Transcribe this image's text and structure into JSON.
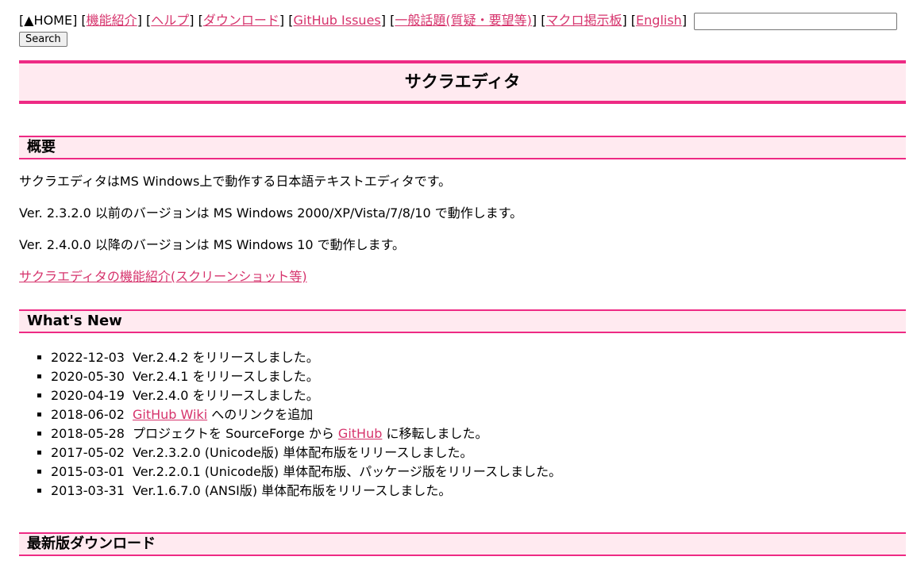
{
  "nav": {
    "home": "[▲HOME]",
    "links": [
      {
        "label": "機能紹介"
      },
      {
        "label": "ヘルプ"
      },
      {
        "label": "ダウンロード"
      },
      {
        "label": "GitHub Issues"
      },
      {
        "label": "一般話題(質疑・要望等)"
      },
      {
        "label": "マクロ掲示板"
      },
      {
        "label": "English"
      }
    ],
    "search_value": "",
    "search_button": "Search"
  },
  "page_title": "サクラエディタ",
  "overview": {
    "heading": "概要",
    "p1": "サクラエディタはMS Windows上で動作する日本語テキストエディタです。",
    "p2": "Ver. 2.3.2.0 以前のバージョンは MS Windows 2000/XP/Vista/7/8/10 で動作します。",
    "p3": "Ver. 2.4.0.0 以降のバージョンは MS Windows 10 で動作します。",
    "features_link": "サクラエディタの機能紹介(スクリーンショット等)"
  },
  "whats_new": {
    "heading": "What's New",
    "items": [
      {
        "date": "2022-12-03",
        "text": "Ver.2.4.2 をリリースしました。"
      },
      {
        "date": "2020-05-30",
        "text": "Ver.2.4.1 をリリースしました。"
      },
      {
        "date": "2020-04-19",
        "text": "Ver.2.4.0 をリリースしました。"
      },
      {
        "date": "2018-06-02",
        "link": "GitHub Wiki",
        "text": " へのリンクを追加"
      },
      {
        "date": "2018-05-28",
        "pre": "プロジェクトを SourceForge から ",
        "link": "GitHub",
        "text": " に移転しました。"
      },
      {
        "date": "2017-05-02",
        "text": "Ver.2.3.2.0 (Unicode版) 単体配布版をリリースしました。"
      },
      {
        "date": "2015-03-01",
        "text": "Ver.2.2.0.1 (Unicode版) 単体配布版、パッケージ版をリリースしました。"
      },
      {
        "date": "2013-03-31",
        "text": "Ver.1.6.7.0 (ANSI版) 単体配布版をリリースしました。"
      }
    ]
  },
  "download": {
    "heading": "最新版ダウンロード"
  },
  "colors": {
    "accent": "#ee2a84",
    "header_bg": "#ffeaf0",
    "link": "#d6336c"
  }
}
